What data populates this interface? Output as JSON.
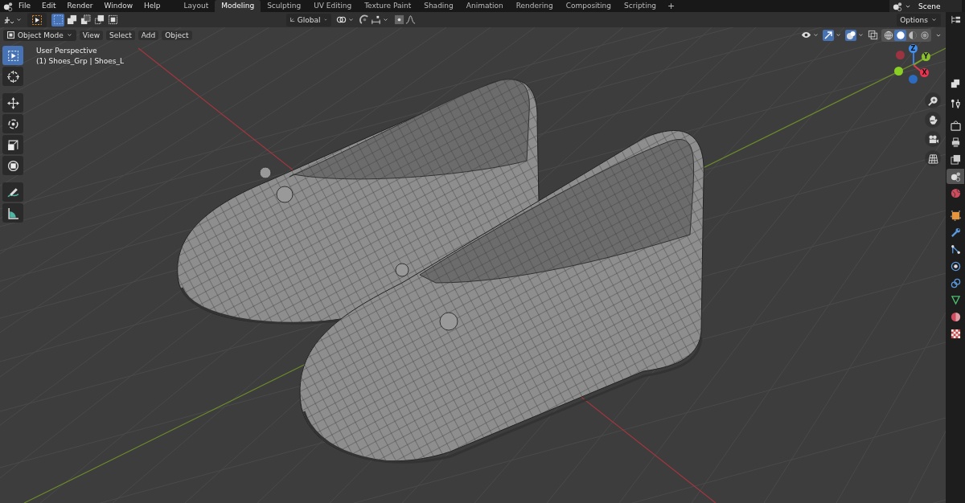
{
  "menu": [
    "File",
    "Edit",
    "Render",
    "Window",
    "Help"
  ],
  "workspaces": [
    {
      "label": "Layout",
      "selected": false
    },
    {
      "label": "Modeling",
      "selected": true
    },
    {
      "label": "Sculpting",
      "selected": false
    },
    {
      "label": "UV Editing",
      "selected": false
    },
    {
      "label": "Texture Paint",
      "selected": false
    },
    {
      "label": "Shading",
      "selected": false
    },
    {
      "label": "Animation",
      "selected": false
    },
    {
      "label": "Rendering",
      "selected": false
    },
    {
      "label": "Compositing",
      "selected": false
    },
    {
      "label": "Scripting",
      "selected": false
    }
  ],
  "add_workspace": "+",
  "scene": "Scene",
  "select_modes": [
    {
      "kind": "set",
      "selected": true
    },
    {
      "kind": "extend",
      "selected": false
    },
    {
      "kind": "subtract",
      "selected": false
    },
    {
      "kind": "invert",
      "selected": false
    },
    {
      "kind": "intersect",
      "selected": false
    }
  ],
  "transform_orientation": "Global",
  "options": "Options",
  "mode": "Object Mode",
  "viewport_menu": [
    "View",
    "Select",
    "Add",
    "Object"
  ],
  "overlay_text": [
    "User Perspective",
    "(1) Shoes_Grp | Shoes_L"
  ],
  "tools": [
    {
      "kind": "select",
      "selected": true
    },
    {
      "kind": "cursor",
      "selected": false
    },
    {
      "kind": "move",
      "selected": false
    },
    {
      "kind": "rotate",
      "selected": false
    },
    {
      "kind": "scale",
      "selected": false
    },
    {
      "kind": "transform",
      "selected": false
    },
    {
      "kind": "annotate",
      "selected": false
    },
    {
      "kind": "measure",
      "selected": false
    }
  ],
  "gizmo": {
    "x": "X",
    "y": "Y",
    "z": "Z"
  },
  "shading_modes": [
    {
      "kind": "wireframe",
      "selected": false
    },
    {
      "kind": "solid",
      "selected": true
    },
    {
      "kind": "material",
      "selected": false
    },
    {
      "kind": "rendered",
      "selected": false
    }
  ],
  "properties_tabs": [
    {
      "kind": "tool",
      "selected": false
    },
    {
      "kind": "render",
      "selected": false
    },
    {
      "kind": "output",
      "selected": false
    },
    {
      "kind": "view_layer",
      "selected": false
    },
    {
      "kind": "scene",
      "selected": true
    },
    {
      "kind": "world",
      "selected": false
    },
    {
      "kind": "object",
      "selected": false
    },
    {
      "kind": "modifiers",
      "selected": false
    },
    {
      "kind": "particles",
      "selected": false
    },
    {
      "kind": "physics",
      "selected": false
    },
    {
      "kind": "constraints",
      "selected": false
    },
    {
      "kind": "data",
      "selected": false
    },
    {
      "kind": "material",
      "selected": false
    },
    {
      "kind": "texture",
      "selected": false
    }
  ]
}
